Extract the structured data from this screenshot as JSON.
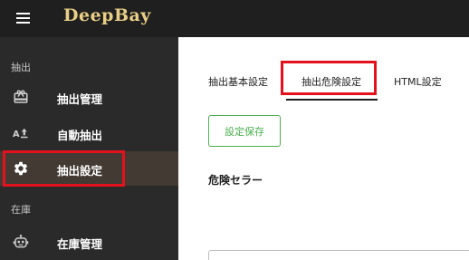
{
  "header": {
    "brand": "DeepBay",
    "menu_icon": "hamburger-menu-icon"
  },
  "sidebar": {
    "sections": [
      {
        "label": "抽出",
        "items": [
          {
            "label": "抽出管理",
            "icon": "gift-icon",
            "active": false,
            "highlighted": false
          },
          {
            "label": "自動抽出",
            "icon": "translate-upload-icon",
            "active": false,
            "highlighted": false
          },
          {
            "label": "抽出設定",
            "icon": "gear-icon",
            "active": true,
            "highlighted": true
          }
        ]
      },
      {
        "label": "在庫",
        "items": [
          {
            "label": "在庫管理",
            "icon": "robot-icon",
            "active": false,
            "highlighted": false
          }
        ]
      }
    ]
  },
  "main": {
    "tabs": [
      {
        "label": "抽出基本設定",
        "active": false,
        "highlighted": false
      },
      {
        "label": "抽出危険設定",
        "active": true,
        "highlighted": true
      },
      {
        "label": "HTML設定",
        "active": false,
        "highlighted": false
      }
    ],
    "save_button": "設定保存",
    "danger_seller_label": "危険セラー",
    "danger_seller_value": ""
  },
  "colors": {
    "topbar": "#1f1f1f",
    "sidebar": "#2a2a2a",
    "active_item": "#433a33",
    "brand": "#e9cf86",
    "highlight": "#e3121d",
    "save_button": "#4caf50"
  }
}
